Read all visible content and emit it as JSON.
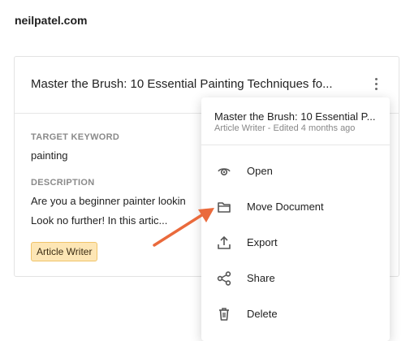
{
  "site": {
    "name": "neilpatel.com"
  },
  "card": {
    "title": "Master the Brush: 10 Essential Painting Techniques fo...",
    "target_keyword_label": "TARGET KEYWORD",
    "target_keyword": "painting",
    "description_label": "DESCRIPTION",
    "description_line1": "Are you a beginner painter lookin",
    "description_line2": "Look no further! In this artic...",
    "badge": "Article Writer"
  },
  "menu": {
    "title": "Master the Brush: 10 Essential P...",
    "subtitle": "Article Writer - Edited 4 months ago",
    "items": [
      {
        "label": "Open",
        "icon": "eye-icon"
      },
      {
        "label": "Move Document",
        "icon": "folder-icon"
      },
      {
        "label": "Export",
        "icon": "upload-icon"
      },
      {
        "label": "Share",
        "icon": "share-icon"
      },
      {
        "label": "Delete",
        "icon": "trash-icon"
      }
    ]
  },
  "colors": {
    "badge_bg": "#fde6b5",
    "badge_border": "#f0c46a",
    "arrow": "#ea6a3c"
  }
}
